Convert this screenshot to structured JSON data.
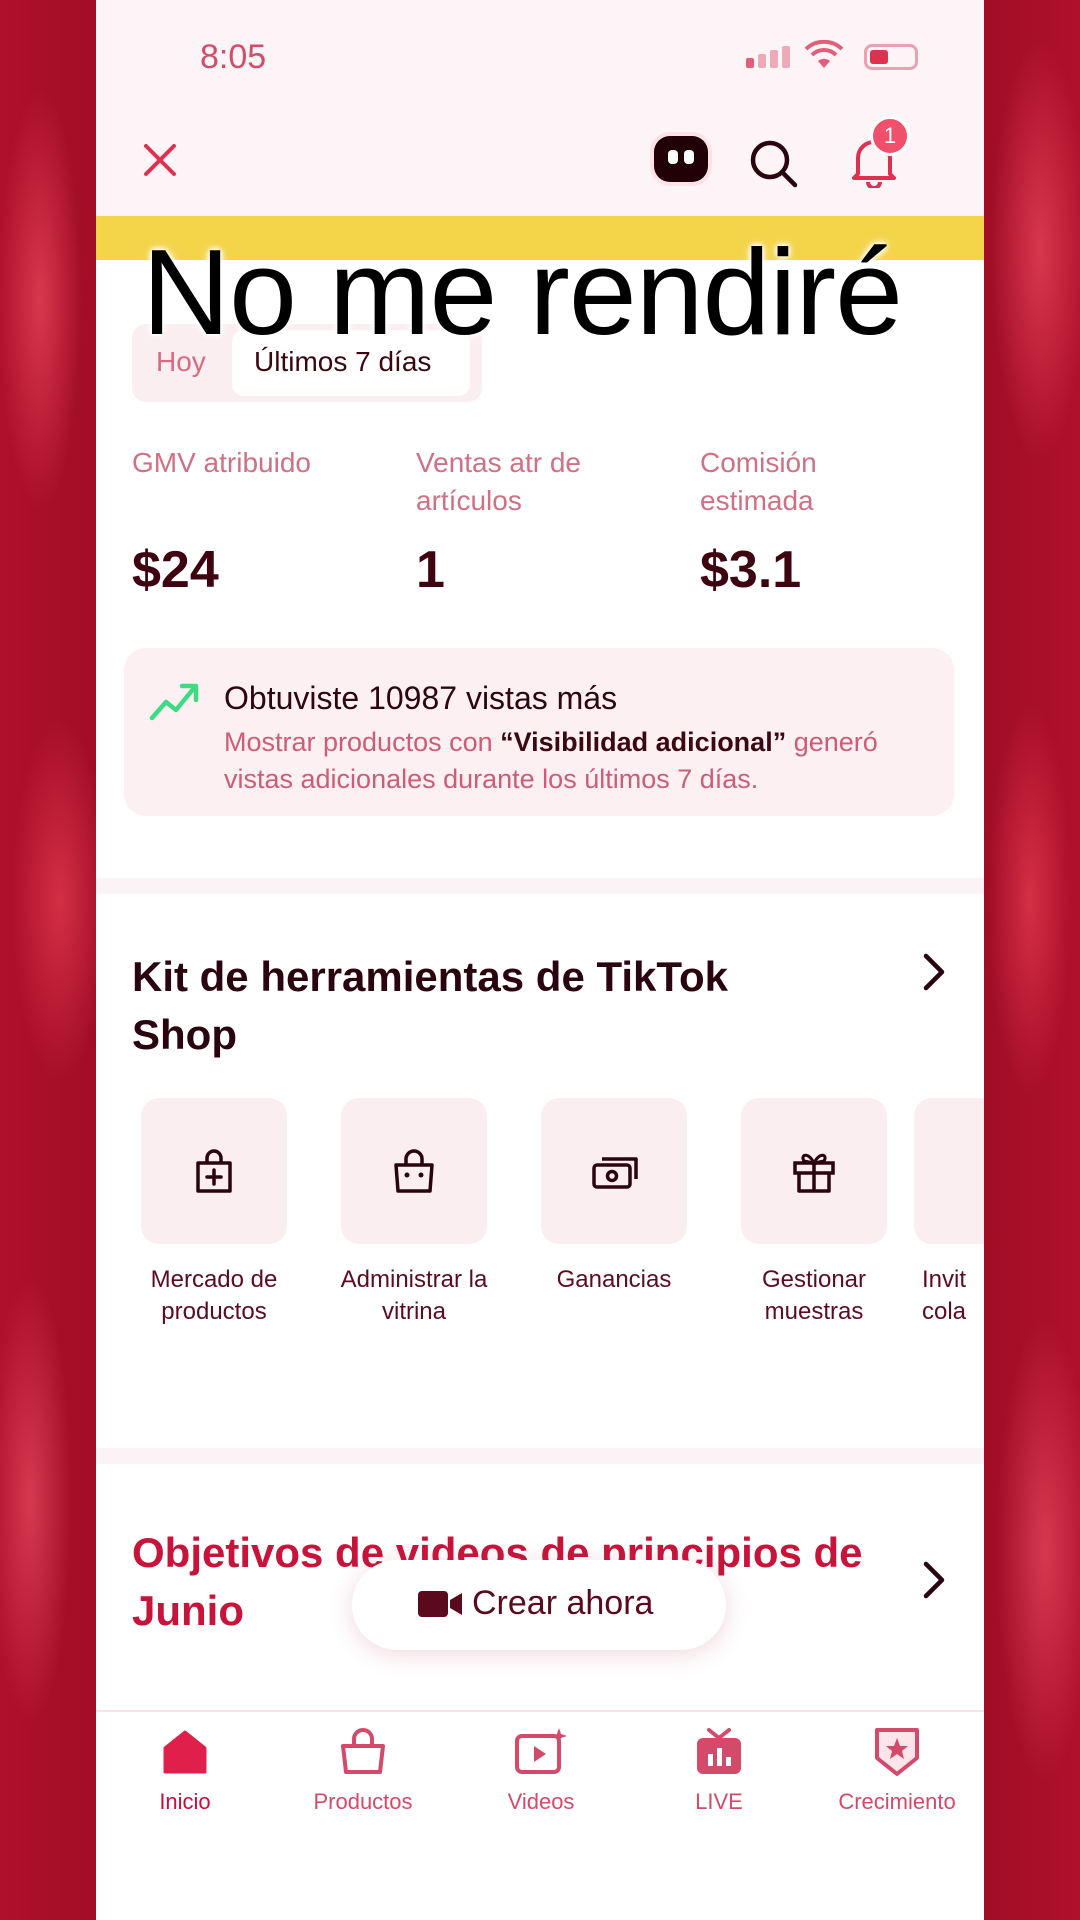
{
  "status_bar": {
    "time": "8:05"
  },
  "top_bar": {
    "notification_count": "1"
  },
  "overlay_caption": "No me rendiré",
  "period_tabs": [
    {
      "label": "Hoy"
    },
    {
      "label": "Últimos 7 días"
    }
  ],
  "metrics": [
    {
      "label_line1": "GMV atribuido",
      "label_line2": "",
      "value": "$24"
    },
    {
      "label_line1": "Ventas atr de",
      "label_line2": "artículos",
      "value": "1"
    },
    {
      "label_line1": "Comisión",
      "label_line2": "estimada",
      "value": "$3.1"
    }
  ],
  "insight_card": {
    "title": "Obtuviste 10987 vistas más",
    "desc_prefix": "Mostrar productos con ",
    "desc_highlight": "“Visibilidad adicional”",
    "desc_suffix": " generó vistas adicionales durante los últimos 7 días."
  },
  "toolkit": {
    "title": "Kit de herramientas de TikTok Shop",
    "tools": [
      {
        "label": "Mercado de productos",
        "icon": "bag-plus-icon"
      },
      {
        "label": "Administrar la vitrina",
        "icon": "shopping-bag-icon"
      },
      {
        "label": "Ganancias",
        "icon": "money-icon"
      },
      {
        "label": "Gestionar muestras",
        "icon": "gift-icon"
      },
      {
        "label": "Invit cola",
        "icon": "invite-icon"
      }
    ]
  },
  "objectives": {
    "title": "Objetivos de videos de principios de Junio"
  },
  "create_button": {
    "label": "Crear ahora"
  },
  "bottom_nav": [
    {
      "label": "Inicio",
      "icon": "home-icon"
    },
    {
      "label": "Productos",
      "icon": "shopping-bag-icon"
    },
    {
      "label": "Videos",
      "icon": "video-play-icon"
    },
    {
      "label": "LIVE",
      "icon": "live-tv-icon"
    },
    {
      "label": "Crecimiento",
      "icon": "badge-star-icon"
    }
  ],
  "colors": {
    "accent": "#c4103c",
    "soft_pink": "#fbeef1",
    "highlight_bar": "#f4d449",
    "trend_green": "#3ddc84"
  }
}
